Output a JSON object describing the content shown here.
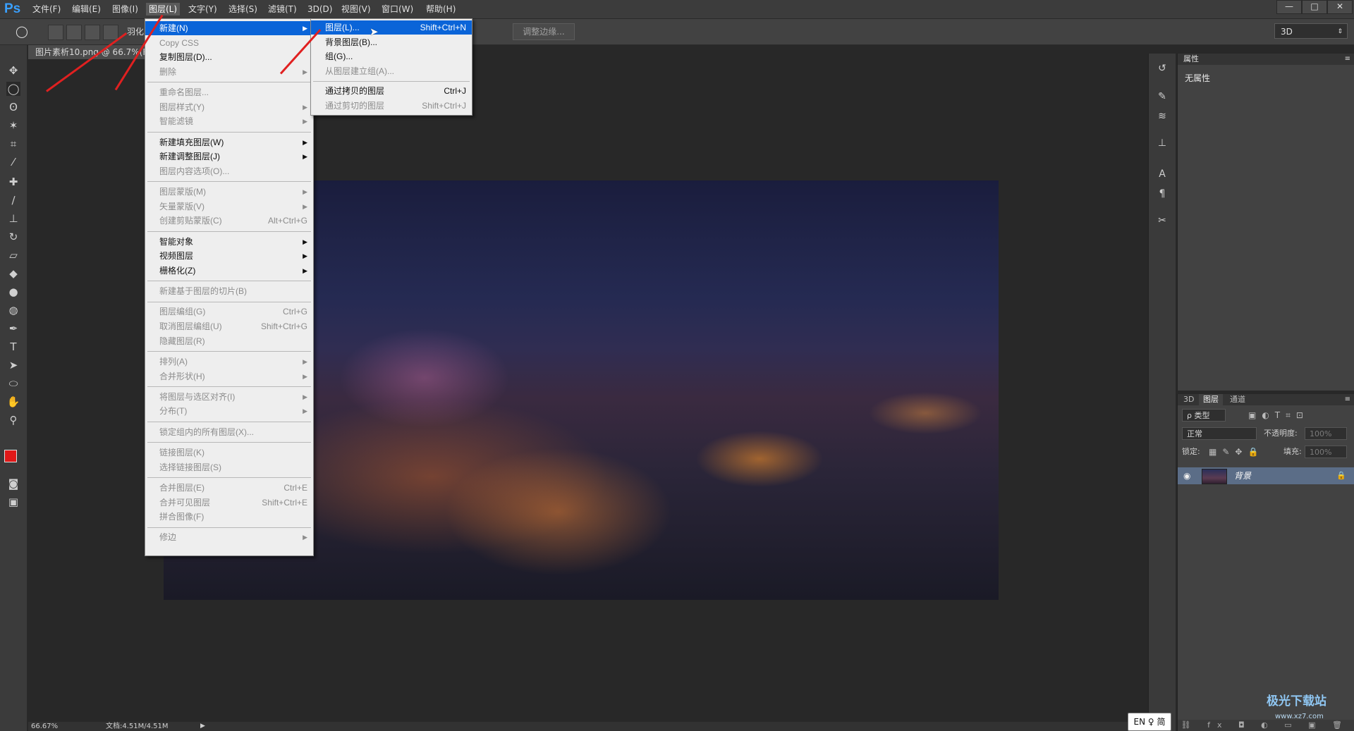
{
  "app": {
    "logo": "Ps",
    "window_controls": [
      "—",
      "□",
      "✕"
    ]
  },
  "menubar": [
    "文件(F)",
    "编辑(E)",
    "图像(I)",
    "图层(L)",
    "文字(Y)",
    "选择(S)",
    "滤镜(T)",
    "3D(D)",
    "视图(V)",
    "窗口(W)",
    "帮助(H)"
  ],
  "options": {
    "feather_label": "羽化",
    "adjust_edge": "调整边缘...",
    "workspace": "3D"
  },
  "document": {
    "tab_title": "图片素析10.png @ 66.7%(R..."
  },
  "layer_menu": [
    {
      "label": "新建(N)",
      "submenu": true,
      "state": "highlighted"
    },
    {
      "label": "Copy CSS",
      "state": "disabled"
    },
    {
      "label": "复制图层(D)...",
      "state": "enabled"
    },
    {
      "label": "删除",
      "submenu": true,
      "state": "disabled"
    },
    {
      "sep": true
    },
    {
      "label": "重命名图层...",
      "state": "disabled"
    },
    {
      "label": "图层样式(Y)",
      "submenu": true,
      "state": "disabled"
    },
    {
      "label": "智能滤镜",
      "submenu": true,
      "state": "disabled"
    },
    {
      "sep": true
    },
    {
      "label": "新建填充图层(W)",
      "submenu": true,
      "state": "enabled"
    },
    {
      "label": "新建调整图层(J)",
      "submenu": true,
      "state": "enabled"
    },
    {
      "label": "图层内容选项(O)...",
      "state": "disabled"
    },
    {
      "sep": true
    },
    {
      "label": "图层蒙版(M)",
      "submenu": true,
      "state": "disabled"
    },
    {
      "label": "矢量蒙版(V)",
      "submenu": true,
      "state": "disabled"
    },
    {
      "label": "创建剪贴蒙版(C)",
      "shortcut": "Alt+Ctrl+G",
      "state": "disabled"
    },
    {
      "sep": true
    },
    {
      "label": "智能对象",
      "submenu": true,
      "state": "enabled"
    },
    {
      "label": "视频图层",
      "submenu": true,
      "state": "enabled"
    },
    {
      "label": "栅格化(Z)",
      "submenu": true,
      "state": "enabled"
    },
    {
      "sep": true
    },
    {
      "label": "新建基于图层的切片(B)",
      "state": "disabled"
    },
    {
      "sep": true
    },
    {
      "label": "图层编组(G)",
      "shortcut": "Ctrl+G",
      "state": "disabled"
    },
    {
      "label": "取消图层编组(U)",
      "shortcut": "Shift+Ctrl+G",
      "state": "disabled"
    },
    {
      "label": "隐藏图层(R)",
      "state": "disabled"
    },
    {
      "sep": true
    },
    {
      "label": "排列(A)",
      "submenu": true,
      "state": "disabled"
    },
    {
      "label": "合并形状(H)",
      "submenu": true,
      "state": "disabled"
    },
    {
      "sep": true
    },
    {
      "label": "将图层与选区对齐(I)",
      "submenu": true,
      "state": "disabled"
    },
    {
      "label": "分布(T)",
      "submenu": true,
      "state": "disabled"
    },
    {
      "sep": true
    },
    {
      "label": "锁定组内的所有图层(X)...",
      "state": "disabled"
    },
    {
      "sep": true
    },
    {
      "label": "链接图层(K)",
      "state": "disabled"
    },
    {
      "label": "选择链接图层(S)",
      "state": "disabled"
    },
    {
      "sep": true
    },
    {
      "label": "合并图层(E)",
      "shortcut": "Ctrl+E",
      "state": "disabled"
    },
    {
      "label": "合并可见图层",
      "shortcut": "Shift+Ctrl+E",
      "state": "disabled"
    },
    {
      "label": "拼合图像(F)",
      "state": "disabled"
    },
    {
      "sep": true
    },
    {
      "label": "修边",
      "submenu": true,
      "state": "disabled"
    }
  ],
  "new_submenu": [
    {
      "label": "图层(L)...",
      "shortcut": "Shift+Ctrl+N",
      "state": "highlighted"
    },
    {
      "label": "背景图层(B)...",
      "state": "enabled"
    },
    {
      "label": "组(G)...",
      "state": "enabled"
    },
    {
      "label": "从图层建立组(A)...",
      "state": "disabled"
    },
    {
      "sep": true
    },
    {
      "label": "通过拷贝的图层",
      "shortcut": "Ctrl+J",
      "state": "enabled"
    },
    {
      "label": "通过剪切的图层",
      "shortcut": "Shift+Ctrl+J",
      "state": "disabled"
    }
  ],
  "properties_panel": {
    "tab": "属性",
    "content": "无属性"
  },
  "layers_panel": {
    "tabs": [
      "3D",
      "图层",
      "通道"
    ],
    "filter_label": "ρ 类型",
    "blend_mode": "正常",
    "opacity_label": "不透明度:",
    "opacity_value": "100%",
    "lock_label": "锁定:",
    "fill_label": "填充:",
    "fill_value": "100%",
    "layer_name": "背景"
  },
  "status": {
    "zoom": "66.67%",
    "doc_info": "文档:4.51M/4.51M"
  },
  "input_method": "EN ♀ 简",
  "watermark": {
    "line1": "极光下载站",
    "line2": "www.xz7.com"
  },
  "colors": {
    "accent": "#0a64d8",
    "arrow": "#e02020",
    "foreground_swatch": "#e01818",
    "background_swatch": "#ffffff"
  },
  "icons": [
    "move-icon",
    "marquee-icon",
    "lasso-icon",
    "magic-wand-icon",
    "crop-icon",
    "eyedropper-icon",
    "healing-icon",
    "brush-icon",
    "stamp-icon",
    "history-brush-icon",
    "eraser-icon",
    "bucket-icon",
    "blur-icon",
    "dodge-icon",
    "pen-icon",
    "type-icon",
    "path-select-icon",
    "shape-icon",
    "hand-icon",
    "zoom-icon"
  ]
}
